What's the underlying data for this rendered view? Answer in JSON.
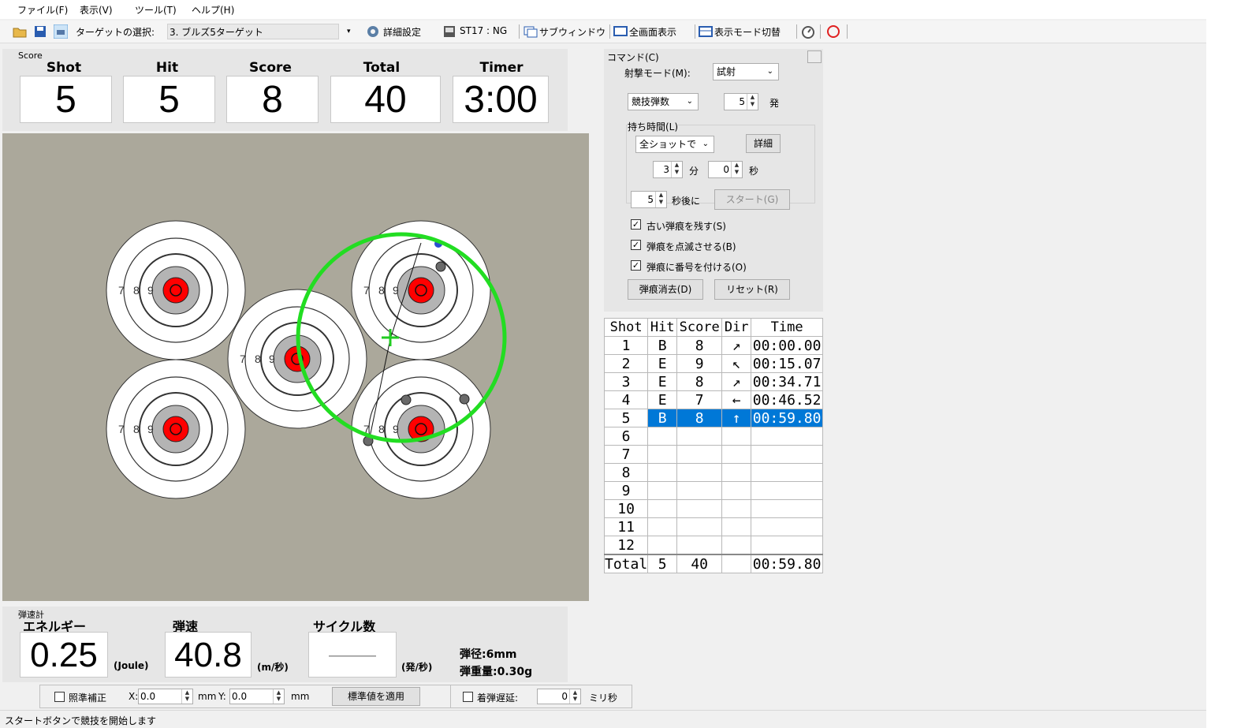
{
  "menu": [
    "ファイル(F)",
    "表示(V)",
    "ツール(T)",
    "ヘルプ(H)"
  ],
  "toolbar": {
    "target_label": "ターゲットの選択:",
    "target_value": "3. ブルズ5ターゲット",
    "detail_settings": "詳細設定",
    "st17": "ST17 : NG",
    "sub_window": "サブウィンドウ",
    "fullscreen": "全画面表示",
    "display_toggle": "表示モード切替"
  },
  "score": {
    "group_label": "Score",
    "headers": [
      "Shot",
      "Hit",
      "Score",
      "Total",
      "Timer"
    ],
    "values": [
      "5",
      "5",
      "8",
      "40",
      "3:00"
    ]
  },
  "target": {
    "ring_labels": [
      "7",
      "8",
      "9"
    ]
  },
  "command": {
    "group_label": "コマンド(C)",
    "mode_label": "射撃モード(M):",
    "mode_value": "試射",
    "count_mode": "競技弾数",
    "count_value": "5",
    "count_unit": "発",
    "hold_label": "持ち時間(L)",
    "hold_mode": "全ショットで",
    "detail_button": "詳細",
    "minutes": "3",
    "minutes_unit": "分",
    "seconds": "0",
    "seconds_unit": "秒",
    "delay_value": "5",
    "delay_unit": "秒後に",
    "start_button": "スタート(G)",
    "check_keep": "古い弾痕を残す(S)",
    "check_blink": "弾痕を点滅させる(B)",
    "check_number": "弾痕に番号を付ける(O)",
    "clear_button": "弾痕消去(D)",
    "reset_button": "リセット(R)"
  },
  "shots": {
    "headers": [
      "Shot",
      "Hit",
      "Score",
      "Dir",
      "Time"
    ],
    "rows": [
      [
        "1",
        "B",
        "8",
        "↗",
        "00:00.00"
      ],
      [
        "2",
        "E",
        "9",
        "↖",
        "00:15.07"
      ],
      [
        "3",
        "E",
        "8",
        "↗",
        "00:34.71"
      ],
      [
        "4",
        "E",
        "7",
        "←",
        "00:46.52"
      ],
      [
        "5",
        "B",
        "8",
        "↑",
        "00:59.80"
      ],
      [
        "6",
        "",
        "",
        "",
        ""
      ],
      [
        "7",
        "",
        "",
        "",
        ""
      ],
      [
        "8",
        "",
        "",
        "",
        ""
      ],
      [
        "9",
        "",
        "",
        "",
        ""
      ],
      [
        "10",
        "",
        "",
        "",
        ""
      ],
      [
        "11",
        "",
        "",
        "",
        ""
      ],
      [
        "12",
        "",
        "",
        "",
        ""
      ]
    ],
    "total": [
      "Total",
      "5",
      "40",
      "",
      "00:59.80"
    ]
  },
  "ballistics": {
    "group_label": "弾速計",
    "energy_label": "エネルギー",
    "energy_value": "0.25",
    "energy_unit": "(Joule)",
    "speed_label": "弾速",
    "speed_value": "40.8",
    "speed_unit": "(m/秒)",
    "cycle_label": "サイクル数",
    "cycle_value": "———",
    "cycle_unit": "(発/秒)",
    "diameter": "弾径:6mm",
    "weight": "弾重量:0.30g"
  },
  "options": {
    "sight_label": "照準補正",
    "x_label": "X:",
    "x_value": "0.0",
    "y_label": "Y:",
    "y_value": "0.0",
    "mm": "mm",
    "apply_button": "標準値を適用",
    "delay_label": "着弾遅延:",
    "delay_value": "0",
    "delay_unit": "ミリ秒"
  },
  "status": "スタートボタンで競技を開始します",
  "colors": {
    "target_bg": "#aba89b",
    "bull": "#ff0000",
    "aim_circle": "#22dd22",
    "selection": "#0078d7"
  }
}
